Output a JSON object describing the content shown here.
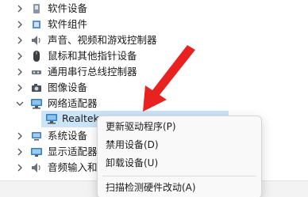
{
  "device_tree": {
    "items": [
      {
        "label": "软件设备",
        "icon": "software-device-icon"
      },
      {
        "label": "软件组件",
        "icon": "software-component-icon"
      },
      {
        "label": "声音、视频和游戏控制器",
        "icon": "speaker-icon"
      },
      {
        "label": "鼠标和其他指针设备",
        "icon": "mouse-icon"
      },
      {
        "label": "通用串行总线控制器",
        "icon": "usb-icon"
      },
      {
        "label": "图像设备",
        "icon": "camera-icon"
      },
      {
        "label": "网络适配器",
        "icon": "network-adapter-icon",
        "expanded": true
      },
      {
        "label": "系统设备",
        "icon": "system-device-icon"
      },
      {
        "label": "显示适配器",
        "icon": "display-adapter-icon"
      },
      {
        "label": "音频输入和输出",
        "icon": "audio-io-icon"
      }
    ],
    "selected_child": {
      "label": "Realtek",
      "icon": "network-adapter-icon"
    }
  },
  "context_menu": {
    "items": [
      {
        "label": "更新驱动程序(P)"
      },
      {
        "label": "禁用设备(D)"
      },
      {
        "label": "卸载设备(U)"
      },
      {
        "label": "扫描检测硬件改动(A)"
      }
    ]
  },
  "colors": {
    "selection": "#cce4f7",
    "arrow": "#e8231f",
    "menu_bg": "#f9f9f9"
  }
}
